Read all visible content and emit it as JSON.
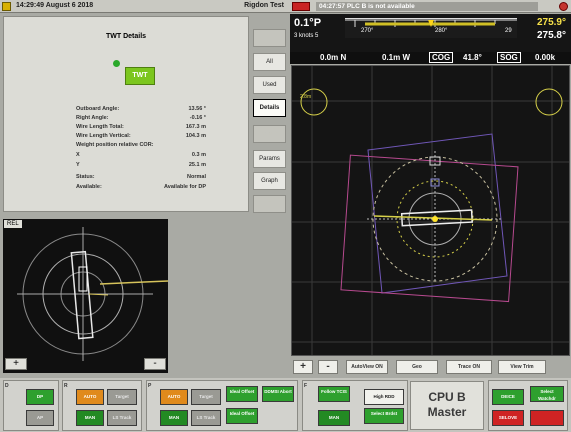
{
  "left_title": {
    "time": "14:29:49 August 6 2018",
    "site": "Rigdon Test"
  },
  "details": {
    "title": "TWT Details",
    "twr_button": "TWT",
    "rows": [
      {
        "k": "Outboard Angle:",
        "v": "13.56 °"
      },
      {
        "k": "Right Angle:",
        "v": "-0.16 °"
      },
      {
        "k": "Wire Length Total:",
        "v": "167.3 m"
      },
      {
        "k": "Wire Length Vertical:",
        "v": "104.3 m"
      },
      {
        "k": "Weight position relative COR:",
        "v": ""
      },
      {
        "k": "X",
        "v": "0.3 m"
      },
      {
        "k": "Y",
        "v": "25.1 m"
      },
      {
        "k": "Status:",
        "v": "Normal"
      },
      {
        "k": "Available:",
        "v": "Available for DP"
      }
    ]
  },
  "side_buttons": [
    "All",
    "Used",
    "Details",
    "Origin",
    "Params",
    "Graph"
  ],
  "mini": {
    "label": "REL",
    "plus": "+",
    "minus": "-"
  },
  "right_title": {
    "message": "04:27:57 PLC B is not available"
  },
  "hdg": {
    "heading_top": "0.1°P",
    "heading_sub": "3 knots 5",
    "scale_labels": [
      "270°",
      "280°",
      "29"
    ],
    "right_big": "275.9°",
    "right_small": "275.8°",
    "line2": [
      "0.0m N",
      "0.1m W",
      "COG",
      "41.8°",
      "SOG",
      "0.00k"
    ]
  },
  "radar_corner": "2.8m",
  "ctl_buttons": [
    "+",
    "-",
    "AutoView ON",
    "Geo",
    "Trace ON",
    "View Trim"
  ],
  "bottom": {
    "groups": [
      {
        "left": "D",
        "buttons": [
          "DP",
          "AP"
        ]
      },
      {
        "left": "R",
        "buttons": [
          "AUTO",
          "Target",
          "MAN",
          "LS Track"
        ]
      },
      {
        "left": "P",
        "buttons": [
          "AUTO",
          "Target",
          "Ideal Offset",
          "DDMSI Abort",
          "MAN",
          "LS Track",
          "Ideal Offset"
        ]
      },
      {
        "left": "F",
        "buttons": [
          "Follow TCIS",
          "High RDD",
          "MAN",
          "Select Brdst"
        ]
      }
    ],
    "cpu": [
      "CPU B",
      "Master"
    ],
    "right": [
      "DEICE",
      "Select Watchdr",
      "SELOVE",
      ""
    ]
  }
}
